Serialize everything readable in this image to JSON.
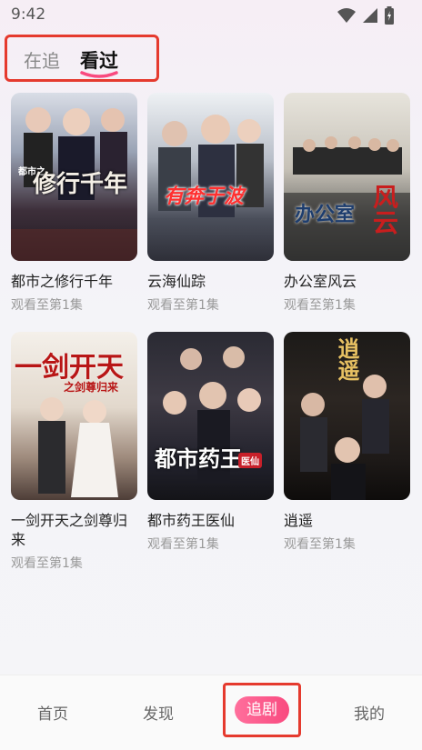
{
  "status_bar": {
    "time": "9:42",
    "icons": [
      "wifi-icon",
      "signal-icon",
      "battery-icon"
    ]
  },
  "tabs": {
    "following": "在追",
    "watched": "看过",
    "active": "watched"
  },
  "shows": [
    {
      "title": "都市之修行千年",
      "progress": "观看至第1集",
      "poster_text": "修行千年",
      "poster_small": "都市之"
    },
    {
      "title": "云海仙踪",
      "progress": "观看至第1集",
      "poster_text": "有奔于波"
    },
    {
      "title": "办公室风云",
      "progress": "观看至第1集",
      "poster_text": "办公室",
      "poster_text2": "风云"
    },
    {
      "title": "一剑开天之剑尊归来",
      "progress": "观看至第1集",
      "poster_text": "一剑开天",
      "poster_small": "之剑尊归来"
    },
    {
      "title": "都市药王医仙",
      "progress": "观看至第1集",
      "poster_text": "都市药王",
      "poster_small": "医仙"
    },
    {
      "title": "逍遥",
      "progress": "观看至第1集",
      "poster_text": "逍遥"
    }
  ],
  "bottom_nav": {
    "home": "首页",
    "discover": "发现",
    "follow": "追剧",
    "mine": "我的",
    "active": "follow"
  },
  "colors": {
    "accent_pink": "#f94a7f",
    "highlight_red": "#e53a2e"
  }
}
